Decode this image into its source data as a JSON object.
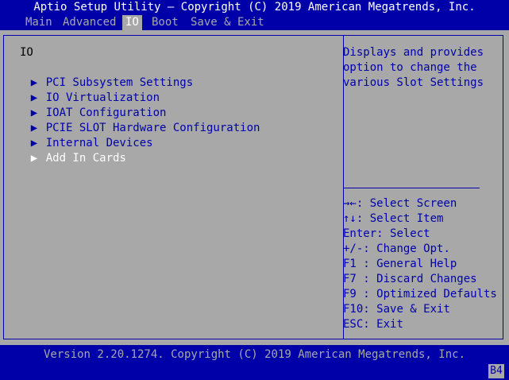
{
  "title": "Aptio Setup Utility – Copyright (C) 2019 American Megatrends, Inc.",
  "tabs": [
    {
      "label": "Main"
    },
    {
      "label": "Advanced"
    },
    {
      "label": "IO"
    },
    {
      "label": "Boot"
    },
    {
      "label": "Save & Exit"
    }
  ],
  "active_tab": "IO",
  "section_title": "IO",
  "menu": [
    {
      "label": "PCI Subsystem Settings"
    },
    {
      "label": "IO Virtualization"
    },
    {
      "label": "IOAT Configuration"
    },
    {
      "label": "PCIE SLOT Hardware Configuration"
    },
    {
      "label": "Internal Devices"
    },
    {
      "label": "Add In Cards"
    }
  ],
  "selected_item": "Add In Cards",
  "arrow_glyph": "▶",
  "help": "Displays and provides\noption to change the\nvarious Slot Settings",
  "keys": [
    {
      "key": "→←",
      "desc": ": Select Screen"
    },
    {
      "key": "↑↓",
      "desc": ": Select Item"
    },
    {
      "key": "Enter",
      "desc": ": Select"
    },
    {
      "key": "+/-",
      "desc": ": Change Opt."
    },
    {
      "key": "F1",
      "desc": " : General Help"
    },
    {
      "key": "F7",
      "desc": " : Discard Changes"
    },
    {
      "key": "F9",
      "desc": " : Optimized Defaults"
    },
    {
      "key": "F10",
      "desc": ": Save & Exit"
    },
    {
      "key": "ESC",
      "desc": ": Exit"
    }
  ],
  "version": "Version 2.20.1274. Copyright (C) 2019 American Megatrends, Inc.",
  "post_code": "B4",
  "colors": {
    "background": "#0000a8",
    "panel": "#a8a8a8",
    "highlight": "#ffffff"
  }
}
